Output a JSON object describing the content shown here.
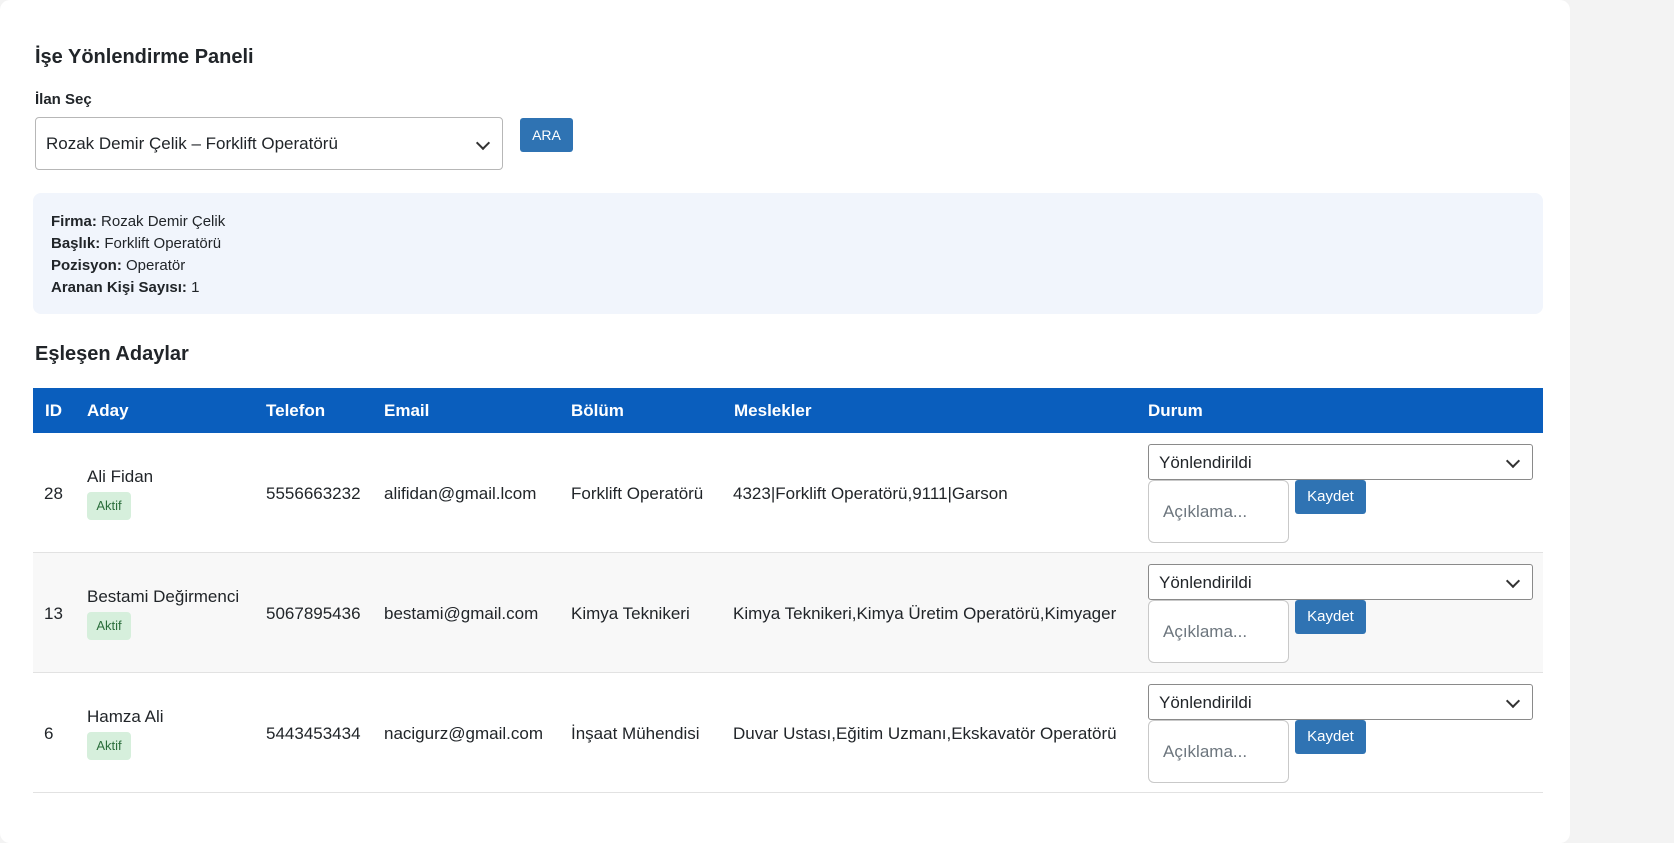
{
  "page": {
    "title": "İşe Yönlendirme Paneli"
  },
  "filter": {
    "label": "İlan Seç",
    "selected": "Rozak Demir Çelik – Forklift Operatörü",
    "search_label": "ARA"
  },
  "info": {
    "firma_label": "Firma:",
    "firma": "Rozak Demir Çelik",
    "baslik_label": "Başlık:",
    "baslik": "Forklift Operatörü",
    "pozisyon_label": "Pozisyon:",
    "pozisyon": "Operatör",
    "kisi_label": "Aranan Kişi Sayısı:",
    "kisi": "1"
  },
  "candidates": {
    "title": "Eşleşen Adaylar",
    "columns": [
      "ID",
      "Aday",
      "Telefon",
      "Email",
      "Bölüm",
      "Meslekler",
      "Durum"
    ],
    "rows": [
      {
        "id": "28",
        "name": "Ali Fidan",
        "badge": "Aktif",
        "phone": "5556663232",
        "email": "alifidan@gmail.lcom",
        "department": "Forklift Operatörü",
        "professions": "4323|Forklift Operatörü,9111|Garson",
        "status": "Yönlendirildi",
        "note_placeholder": "Açıklama...",
        "save_label": "Kaydet"
      },
      {
        "id": "13",
        "name": "Bestami Değirmenci",
        "badge": "Aktif",
        "phone": "5067895436",
        "email": "bestami@gmail.com",
        "department": "Kimya Teknikeri",
        "professions": "Kimya Teknikeri,Kimya Üretim Operatörü,Kimyager",
        "status": "Yönlendirildi",
        "note_placeholder": "Açıklama...",
        "save_label": "Kaydet"
      },
      {
        "id": "6",
        "name": "Hamza Ali",
        "badge": "Aktif",
        "phone": "5443453434",
        "email": "nacigurz@gmail.com",
        "department": "İnşaat Mühendisi",
        "professions": "Duvar Ustası,Eğitim Uzmanı,Ekskavatör Operatörü",
        "status": "Yönlendirildi",
        "note_placeholder": "Açıklama...",
        "save_label": "Kaydet"
      }
    ]
  },
  "colors": {
    "header_bg": "#0a5ebd",
    "button_bg": "#2f73b3",
    "badge_bg": "#d6efdc",
    "info_bg": "#f1f5fc"
  }
}
